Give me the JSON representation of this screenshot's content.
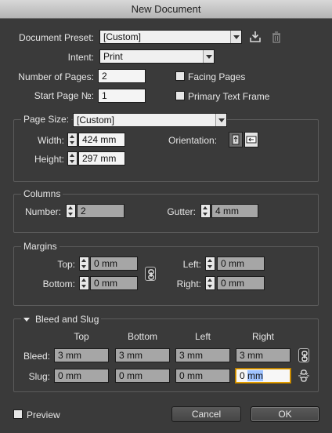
{
  "window": {
    "title": "New Document"
  },
  "preset": {
    "label": "Document Preset:",
    "value": "[Custom]"
  },
  "intent": {
    "label": "Intent:",
    "value": "Print"
  },
  "pages": {
    "number_label": "Number of Pages:",
    "number_value": "2",
    "start_label": "Start Page №:",
    "start_value": "1",
    "facing_label": "Facing Pages",
    "primary_label": "Primary Text Frame"
  },
  "page_size": {
    "legend": "Page Size:",
    "value": "[Custom]",
    "width_label": "Width:",
    "width_value": "424 mm",
    "height_label": "Height:",
    "height_value": "297 mm",
    "orientation_label": "Orientation:"
  },
  "columns": {
    "legend": "Columns",
    "number_label": "Number:",
    "number_value": "2",
    "gutter_label": "Gutter:",
    "gutter_value": "4 mm"
  },
  "margins": {
    "legend": "Margins",
    "top_label": "Top:",
    "top_value": "0 mm",
    "bottom_label": "Bottom:",
    "bottom_value": "0 mm",
    "left_label": "Left:",
    "left_value": "0 mm",
    "right_label": "Right:",
    "right_value": "0 mm"
  },
  "bleed_slug": {
    "legend": "Bleed and Slug",
    "col_top": "Top",
    "col_bottom": "Bottom",
    "col_left": "Left",
    "col_right": "Right",
    "bleed_label": "Bleed:",
    "bleed_top": "3 mm",
    "bleed_bottom": "3 mm",
    "bleed_left": "3 mm",
    "bleed_right": "3 mm",
    "slug_label": "Slug:",
    "slug_top": "0 mm",
    "slug_bottom": "0 mm",
    "slug_left": "0 mm",
    "slug_right_a": "0 ",
    "slug_right_b": "mm"
  },
  "footer": {
    "preview_label": "Preview",
    "cancel_label": "Cancel",
    "ok_label": "OK"
  },
  "icons": {
    "save_preset": "save-icon",
    "delete_preset": "trash-icon",
    "link": "chain-link-icon"
  }
}
